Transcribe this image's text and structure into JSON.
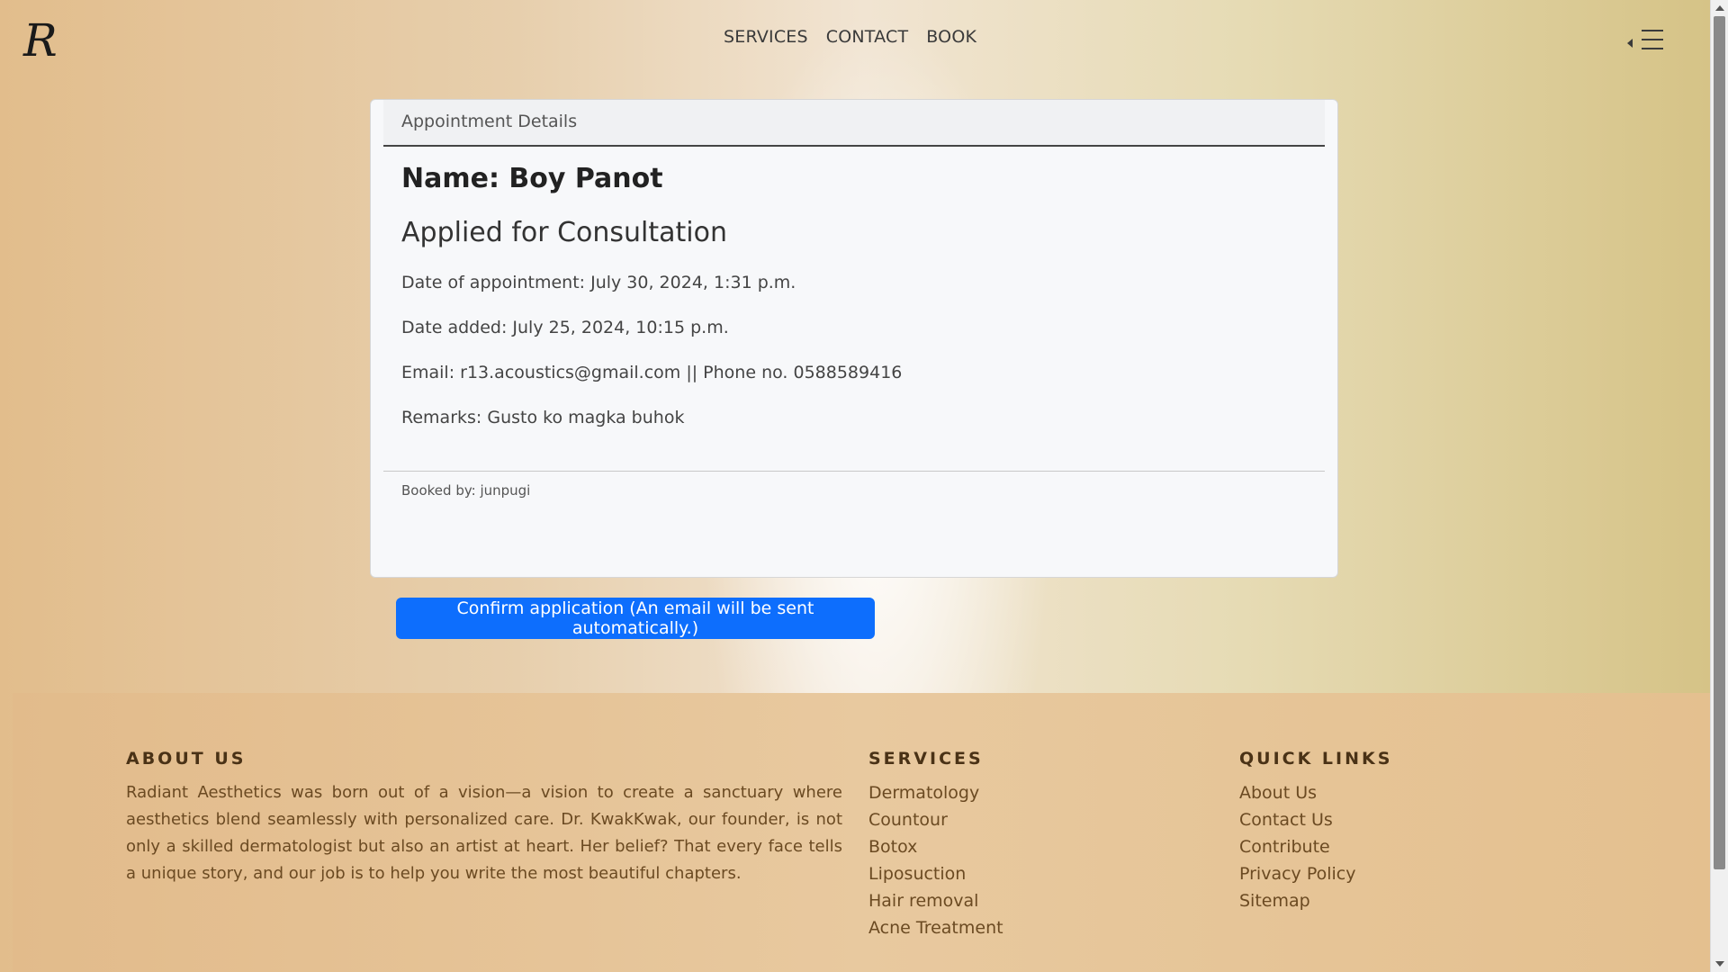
{
  "header": {
    "logo_letter": "R",
    "nav": [
      "SERVICES",
      "CONTACT",
      "BOOK"
    ]
  },
  "card": {
    "header_title": "Appointment Details",
    "name": "Name: Boy Panot",
    "applied": "Applied for Consultation",
    "date_appointment": "Date of appointment: July 30, 2024, 1:31 p.m.",
    "date_added": "Date added: July 25, 2024, 10:15 p.m.",
    "contact": "Email: r13.acoustics@gmail.com || Phone no. 0588589416",
    "remarks": "Remarks: Gusto ko magka buhok",
    "booked_by": "Booked by: junpugi"
  },
  "confirm_button": "Confirm application (An email will be sent automatically.)",
  "footer": {
    "about_heading": "ABOUT US",
    "about_text": "Radiant Aesthetics was born out of a vision—a vision to create a sanctuary where aesthetics blend seamlessly with personalized care. Dr. KwakKwak, our founder, is not only a skilled dermatologist but also an artist at heart. Her belief? That every face tells a unique story, and our job is to help you write the most beautiful chapters.",
    "services_heading": "SERVICES",
    "services": [
      "Dermatology",
      "Countour",
      "Botox",
      "Liposuction",
      "Hair removal",
      "Acne Treatment"
    ],
    "links_heading": "QUICK LINKS",
    "links": [
      "About Us",
      "Contact Us",
      "Contribute",
      "Privacy Policy",
      "Sitemap"
    ]
  },
  "colors": {
    "primary_button": "#0d6efd",
    "footer_text": "#6b4a22"
  }
}
